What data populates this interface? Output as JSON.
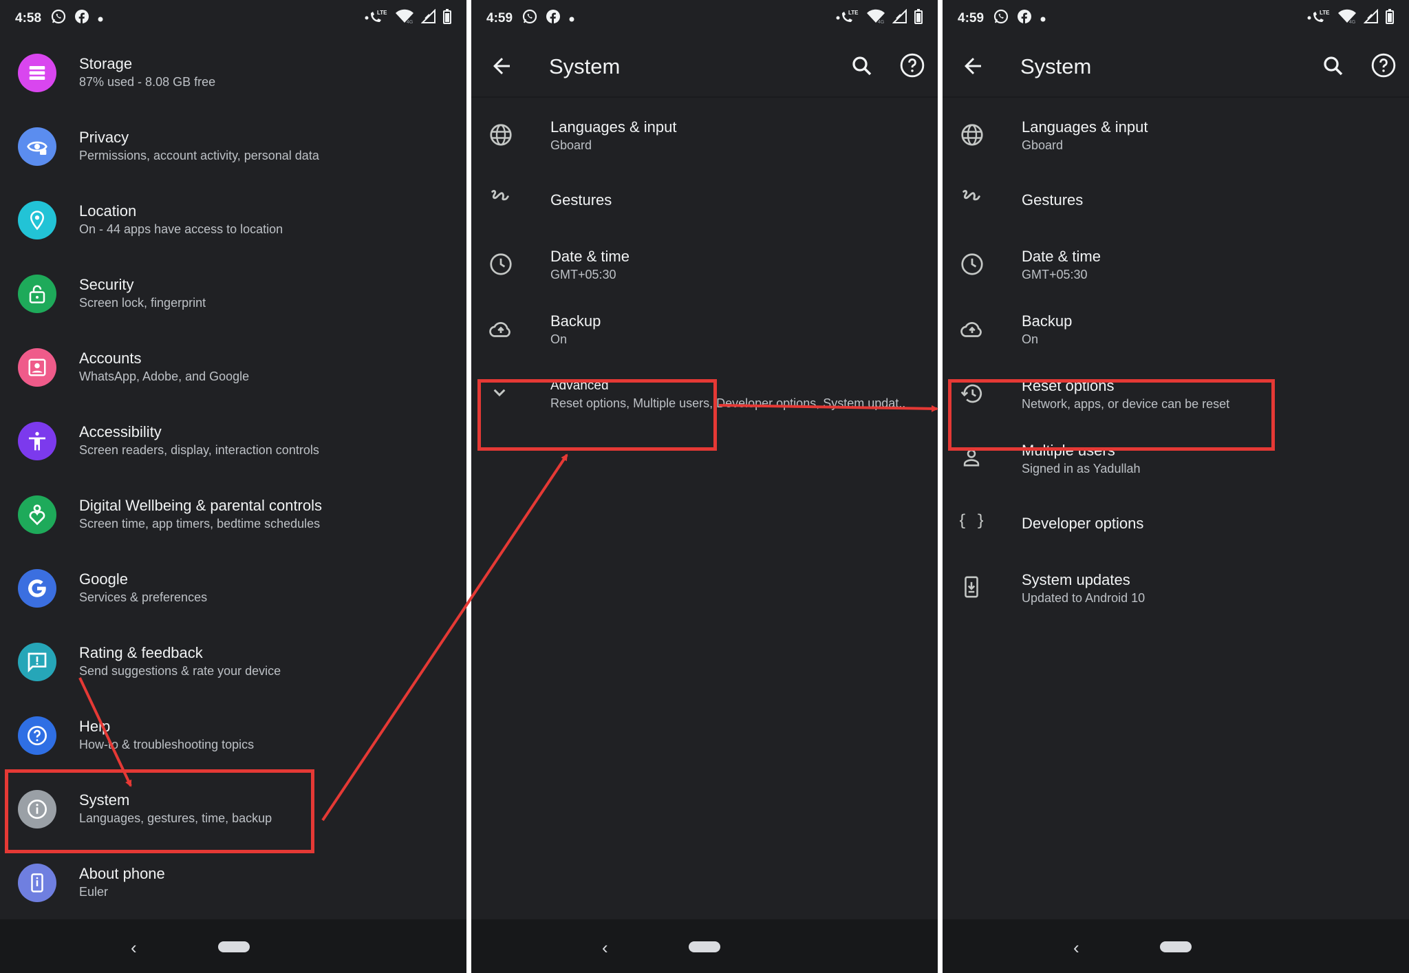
{
  "colors": {
    "accent_red": "#e53935",
    "background": "#202124"
  },
  "panel1": {
    "status": {
      "time": "4:58"
    },
    "items": [
      {
        "title": "Storage",
        "subtitle": "87% used - 8.08 GB free",
        "icon": "storage-icon",
        "color": "#d946ef"
      },
      {
        "title": "Privacy",
        "subtitle": "Permissions, account activity, personal data",
        "icon": "privacy-icon",
        "color": "#5b8def"
      },
      {
        "title": "Location",
        "subtitle": "On - 44 apps have access to location",
        "icon": "location-icon",
        "color": "#22c3d6"
      },
      {
        "title": "Security",
        "subtitle": "Screen lock, fingerprint",
        "icon": "lock-icon",
        "color": "#1eaa5a"
      },
      {
        "title": "Accounts",
        "subtitle": "WhatsApp, Adobe, and Google",
        "icon": "accounts-icon",
        "color": "#ef5b8a"
      },
      {
        "title": "Accessibility",
        "subtitle": "Screen readers, display, interaction controls",
        "icon": "accessibility-icon",
        "color": "#7c3aed"
      },
      {
        "title": "Digital Wellbeing & parental controls",
        "subtitle": "Screen time, app timers, bedtime schedules",
        "icon": "wellbeing-icon",
        "color": "#1eaa5a"
      },
      {
        "title": "Google",
        "subtitle": "Services & preferences",
        "icon": "google-icon",
        "color": "#3b6fe0"
      },
      {
        "title": "Rating & feedback",
        "subtitle": "Send suggestions & rate your device",
        "icon": "feedback-icon",
        "color": "#26a6b8"
      },
      {
        "title": "Help",
        "subtitle": "How-to & troubleshooting topics",
        "icon": "help-icon",
        "color": "#2f6fe4"
      },
      {
        "title": "System",
        "subtitle": "Languages, gestures, time, backup",
        "icon": "info-icon",
        "color": "#9aa0a6"
      },
      {
        "title": "About phone",
        "subtitle": "Euler",
        "icon": "phone-icon",
        "color": "#6f7fe0"
      }
    ]
  },
  "panel2": {
    "status": {
      "time": "4:59"
    },
    "title": "System",
    "items": [
      {
        "title": "Languages & input",
        "subtitle": "Gboard",
        "icon": "globe-icon"
      },
      {
        "title": "Gestures",
        "subtitle": "",
        "icon": "gestures-icon"
      },
      {
        "title": "Date & time",
        "subtitle": "GMT+05:30",
        "icon": "clock-icon"
      },
      {
        "title": "Backup",
        "subtitle": "On",
        "icon": "cloud-upload-icon"
      },
      {
        "title": "Advanced",
        "subtitle": "Reset options, Multiple users, Developer options, System updat..",
        "icon": "chevron-down-icon"
      }
    ]
  },
  "panel3": {
    "status": {
      "time": "4:59"
    },
    "title": "System",
    "items": [
      {
        "title": "Languages & input",
        "subtitle": "Gboard",
        "icon": "globe-icon"
      },
      {
        "title": "Gestures",
        "subtitle": "",
        "icon": "gestures-icon"
      },
      {
        "title": "Date & time",
        "subtitle": "GMT+05:30",
        "icon": "clock-icon"
      },
      {
        "title": "Backup",
        "subtitle": "On",
        "icon": "cloud-upload-icon"
      },
      {
        "title": "Reset options",
        "subtitle": "Network, apps, or device can be reset",
        "icon": "history-icon"
      },
      {
        "title": "Multiple users",
        "subtitle": "Signed in as Yadullah",
        "icon": "person-icon"
      },
      {
        "title": "Developer options",
        "subtitle": "",
        "icon": "braces-icon"
      },
      {
        "title": "System updates",
        "subtitle": "Updated to Android 10",
        "icon": "system-update-icon"
      }
    ]
  }
}
